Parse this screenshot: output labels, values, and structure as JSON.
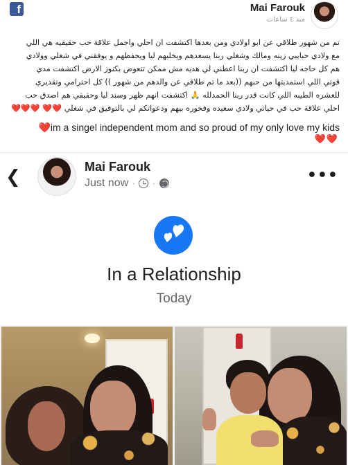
{
  "post": {
    "author_name": "Mai Farouk",
    "timestamp": "منذ ٤ ساعات",
    "text_lines": [
      "تم من شهور طلاقي عن ابو اولادي ومن بعدها اكتشفت ان احلي واجمل علاقة حب حقيقيه هي اللي",
      "مع ولادي حبايبي زينه ومالك وشغلي ربنا يسعدهم ويخليهم ليا ويحفظهم و يوفقني في شغلي وولادي",
      "هم كل حاجه ليا اكتشفت ان ربنا اعطني لي هديه مش ممكن تتعوض بكنوز الارض اكتشفت مدي",
      "قوتي اللي استمديتها من حبهم ((بعد ما تم طلاقي عن والدهم من شهور )) كل احترامي وتقديري",
      "للعشره الطيبه اللي كانت قدر ربنا الحمدلله 🙏 اكتشفت انهم ظهر وسند ليا وحقيقي هم اصدق حب",
      "احلي علاقة حب في حياتي ولادي سعيده وفخوره بيهم ودعواتكم لي بالتوفيق في شغلي ❤️❤️ ❤️❤️❤️"
    ],
    "english_line": "❤️im a singel independent mom and so proud of my only love my kids",
    "trailing_hearts": "❤️❤️"
  },
  "shared": {
    "name": "Mai Farouk",
    "time": "Just now",
    "status_title": "In a Relationship",
    "status_date": "Today"
  },
  "colors": {
    "facebook_blue": "#3b5998",
    "relationship_blue": "#1877f2",
    "heart_red": "#e0245e"
  },
  "icons": {
    "logo": "facebook-logo-icon",
    "back": "back-arrow-icon",
    "clock": "clock-icon",
    "privacy": "globe-icon",
    "more": "more-options-icon",
    "relationship": "hearts-icon"
  }
}
